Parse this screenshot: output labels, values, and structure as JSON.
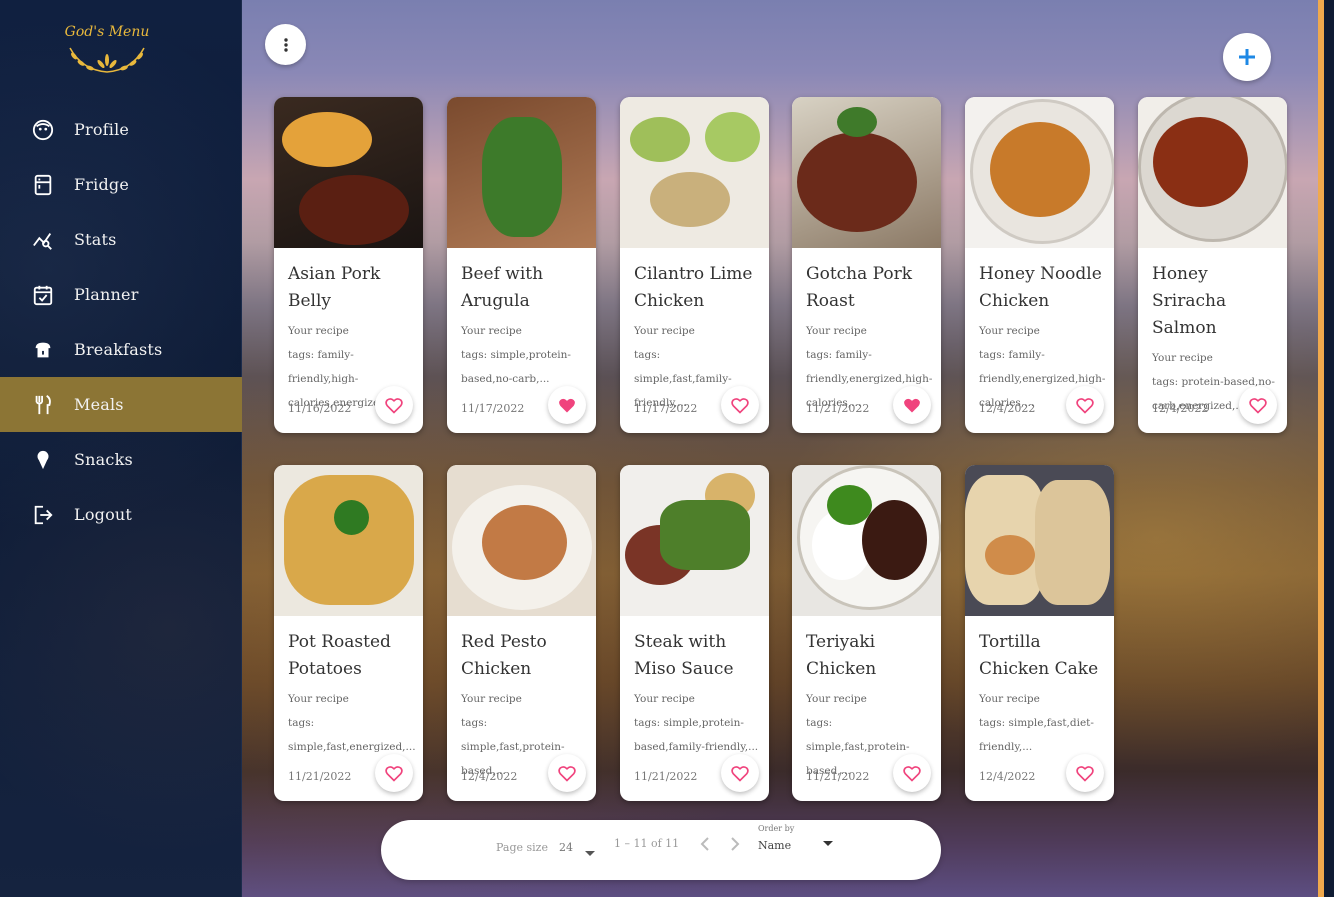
{
  "app": {
    "logo_text": "God's Menu"
  },
  "sidebar": {
    "items": [
      {
        "label": "Profile",
        "icon": "profile-icon"
      },
      {
        "label": "Fridge",
        "icon": "fridge-icon"
      },
      {
        "label": "Stats",
        "icon": "stats-icon"
      },
      {
        "label": "Planner",
        "icon": "calendar-icon"
      },
      {
        "label": "Breakfasts",
        "icon": "toast-icon"
      },
      {
        "label": "Meals",
        "icon": "utensils-icon",
        "active": true
      },
      {
        "label": "Snacks",
        "icon": "ice-cream-icon"
      },
      {
        "label": "Logout",
        "icon": "logout-icon"
      }
    ]
  },
  "colors": {
    "active_nav": "#8c7535",
    "accent_blue": "#1e88e5",
    "heart_pink": "#f0437d",
    "logo_gold": "#e8b83c"
  },
  "cards": [
    {
      "title": "Asian Pork Belly",
      "owner": "Your recipe",
      "tags": "tags: family-friendly,high-calories,energized,...",
      "date": "11/16/2022",
      "favorite": false
    },
    {
      "title": "Beef with Arugula",
      "owner": "Your recipe",
      "tags": "tags: simple,protein-based,no-carb,...",
      "date": "11/17/2022",
      "favorite": true
    },
    {
      "title": "Cilantro Lime Chicken",
      "owner": "Your recipe",
      "tags": "tags: simple,fast,family-friendly,...",
      "date": "11/17/2022",
      "favorite": false
    },
    {
      "title": "Gotcha Pork Roast",
      "owner": "Your recipe",
      "tags": "tags: family-friendly,energized,high-calories,...",
      "date": "11/21/2022",
      "favorite": true
    },
    {
      "title": "Honey Noodle Chicken",
      "owner": "Your recipe",
      "tags": "tags: family-friendly,energized,high-calories,...",
      "date": "12/4/2022",
      "favorite": false
    },
    {
      "title": "Honey Sriracha Salmon",
      "owner": "Your recipe",
      "tags": "tags: protein-based,no-carb,energized,...",
      "date": "12/4/2022",
      "favorite": false
    },
    {
      "title": "Pot Roasted Potatoes",
      "owner": "Your recipe",
      "tags": "tags: simple,fast,energized,...",
      "date": "11/21/2022",
      "favorite": false
    },
    {
      "title": "Red Pesto Chicken",
      "owner": "Your recipe",
      "tags": "tags: simple,fast,protein-based,...",
      "date": "12/4/2022",
      "favorite": false
    },
    {
      "title": "Steak with Miso Sauce",
      "owner": "Your recipe",
      "tags": "tags: simple,protein-based,family-friendly,...",
      "date": "11/21/2022",
      "favorite": false
    },
    {
      "title": "Teriyaki Chicken",
      "owner": "Your recipe",
      "tags": "tags: simple,fast,protein-based,...",
      "date": "11/21/2022",
      "favorite": false
    },
    {
      "title": "Tortilla Chicken Cake",
      "owner": "Your recipe",
      "tags": "tags: simple,fast,diet-friendly,...",
      "date": "12/4/2022",
      "favorite": false
    }
  ],
  "pager": {
    "page_size_label": "Page size",
    "page_size": "24",
    "range": "1 – 11 of 11",
    "order_label": "Order by",
    "order_value": "Name"
  }
}
